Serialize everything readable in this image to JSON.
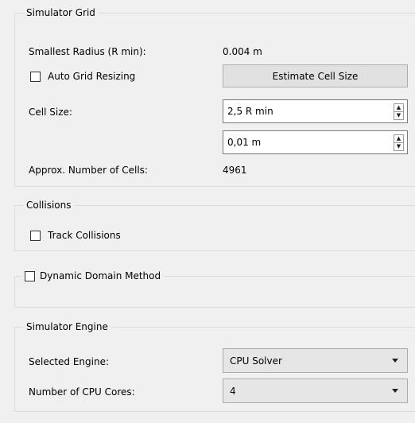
{
  "simulator_grid": {
    "title": "Simulator Grid",
    "smallest_radius_label": "Smallest Radius (R min):",
    "smallest_radius_value": "0.004 m",
    "auto_grid_resizing_label": "Auto Grid Resizing",
    "auto_grid_resizing_checked": false,
    "estimate_button_label": "Estimate Cell Size",
    "cell_size_label": "Cell Size:",
    "cell_size_rmin_value": "2,5 R min",
    "cell_size_m_value": "0,01 m",
    "approx_cells_label": "Approx. Number of Cells:",
    "approx_cells_value": "4961"
  },
  "collisions": {
    "title": "Collisions",
    "track_collisions_label": "Track Collisions",
    "track_collisions_checked": false
  },
  "dynamic_domain": {
    "title": "Dynamic Domain Method",
    "checked": false
  },
  "simulator_engine": {
    "title": "Simulator Engine",
    "selected_engine_label": "Selected Engine:",
    "selected_engine_value": "CPU Solver",
    "cpu_cores_label": "Number of CPU Cores:",
    "cpu_cores_value": "4"
  }
}
